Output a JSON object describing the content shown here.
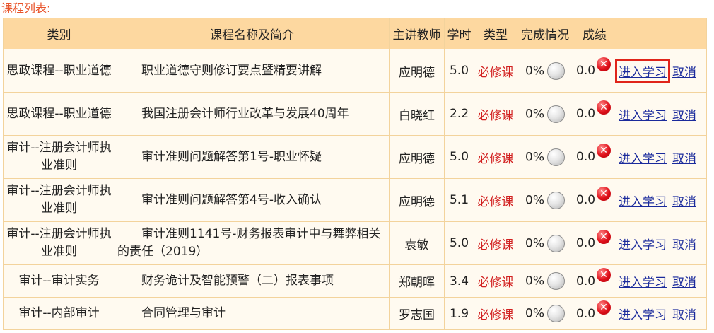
{
  "section_title": "课程列表:",
  "table": {
    "headers": [
      "类别",
      "课程名称及简介",
      "主讲教师",
      "学时",
      "类型",
      "完成情况",
      "成绩",
      ""
    ],
    "rows": [
      {
        "category": "思政课程--职业道德",
        "name": "职业道德守则修订要点暨精要讲解",
        "teacher": "应明德",
        "hours": "5.0",
        "type": "必修课",
        "progress": "0%",
        "score": "0.0",
        "action_study": "进入学习",
        "action_cancel": "取消"
      },
      {
        "category": "思政课程--职业道德",
        "name": "我国注册会计师行业改革与发展40周年",
        "teacher": "白晓红",
        "hours": "2.2",
        "type": "必修课",
        "progress": "0%",
        "score": "0.0",
        "action_study": "进入学习",
        "action_cancel": "取消"
      },
      {
        "category": "审计--注册会计师执业准则",
        "name": "审计准则问题解答第1号-职业怀疑",
        "teacher": "应明德",
        "hours": "5.0",
        "type": "必修课",
        "progress": "0%",
        "score": "0.0",
        "action_study": "进入学习",
        "action_cancel": "取消"
      },
      {
        "category": "审计--注册会计师执业准则",
        "name": "审计准则问题解答第4号-收入确认",
        "teacher": "应明德",
        "hours": "5.1",
        "type": "必修课",
        "progress": "0%",
        "score": "0.0",
        "action_study": "进入学习",
        "action_cancel": "取消"
      },
      {
        "category": "审计--注册会计师执业准则",
        "name": "审计准则1141号-财务报表审计中与舞弊相关的责任（2019）",
        "teacher": "袁敏",
        "hours": "5.0",
        "type": "必修课",
        "progress": "0%",
        "score": "0.0",
        "action_study": "进入学习",
        "action_cancel": "取消"
      },
      {
        "category": "审计--审计实务",
        "name": "财务诡计及智能预警（二）报表事项",
        "teacher": "郑朝晖",
        "hours": "3.4",
        "type": "必修课",
        "progress": "0%",
        "score": "0.0",
        "action_study": "进入学习",
        "action_cancel": "取消"
      },
      {
        "category": "审计--内部审计",
        "name": "合同管理与审计",
        "teacher": "罗志国",
        "hours": "1.9",
        "type": "必修课",
        "progress": "0%",
        "score": "0.0",
        "action_study": "进入学习",
        "action_cancel": "取消"
      }
    ]
  },
  "highlighted_row": 0,
  "icons": {
    "progress": "progress-circle-icon",
    "score": "failed-x-icon"
  },
  "colors": {
    "header_bg": "#fdd8a0",
    "border": "#f3d39c",
    "type_text": "#d22020",
    "link": "#1a2a9c",
    "highlight": "#e0241a",
    "title": "#e8532a"
  }
}
